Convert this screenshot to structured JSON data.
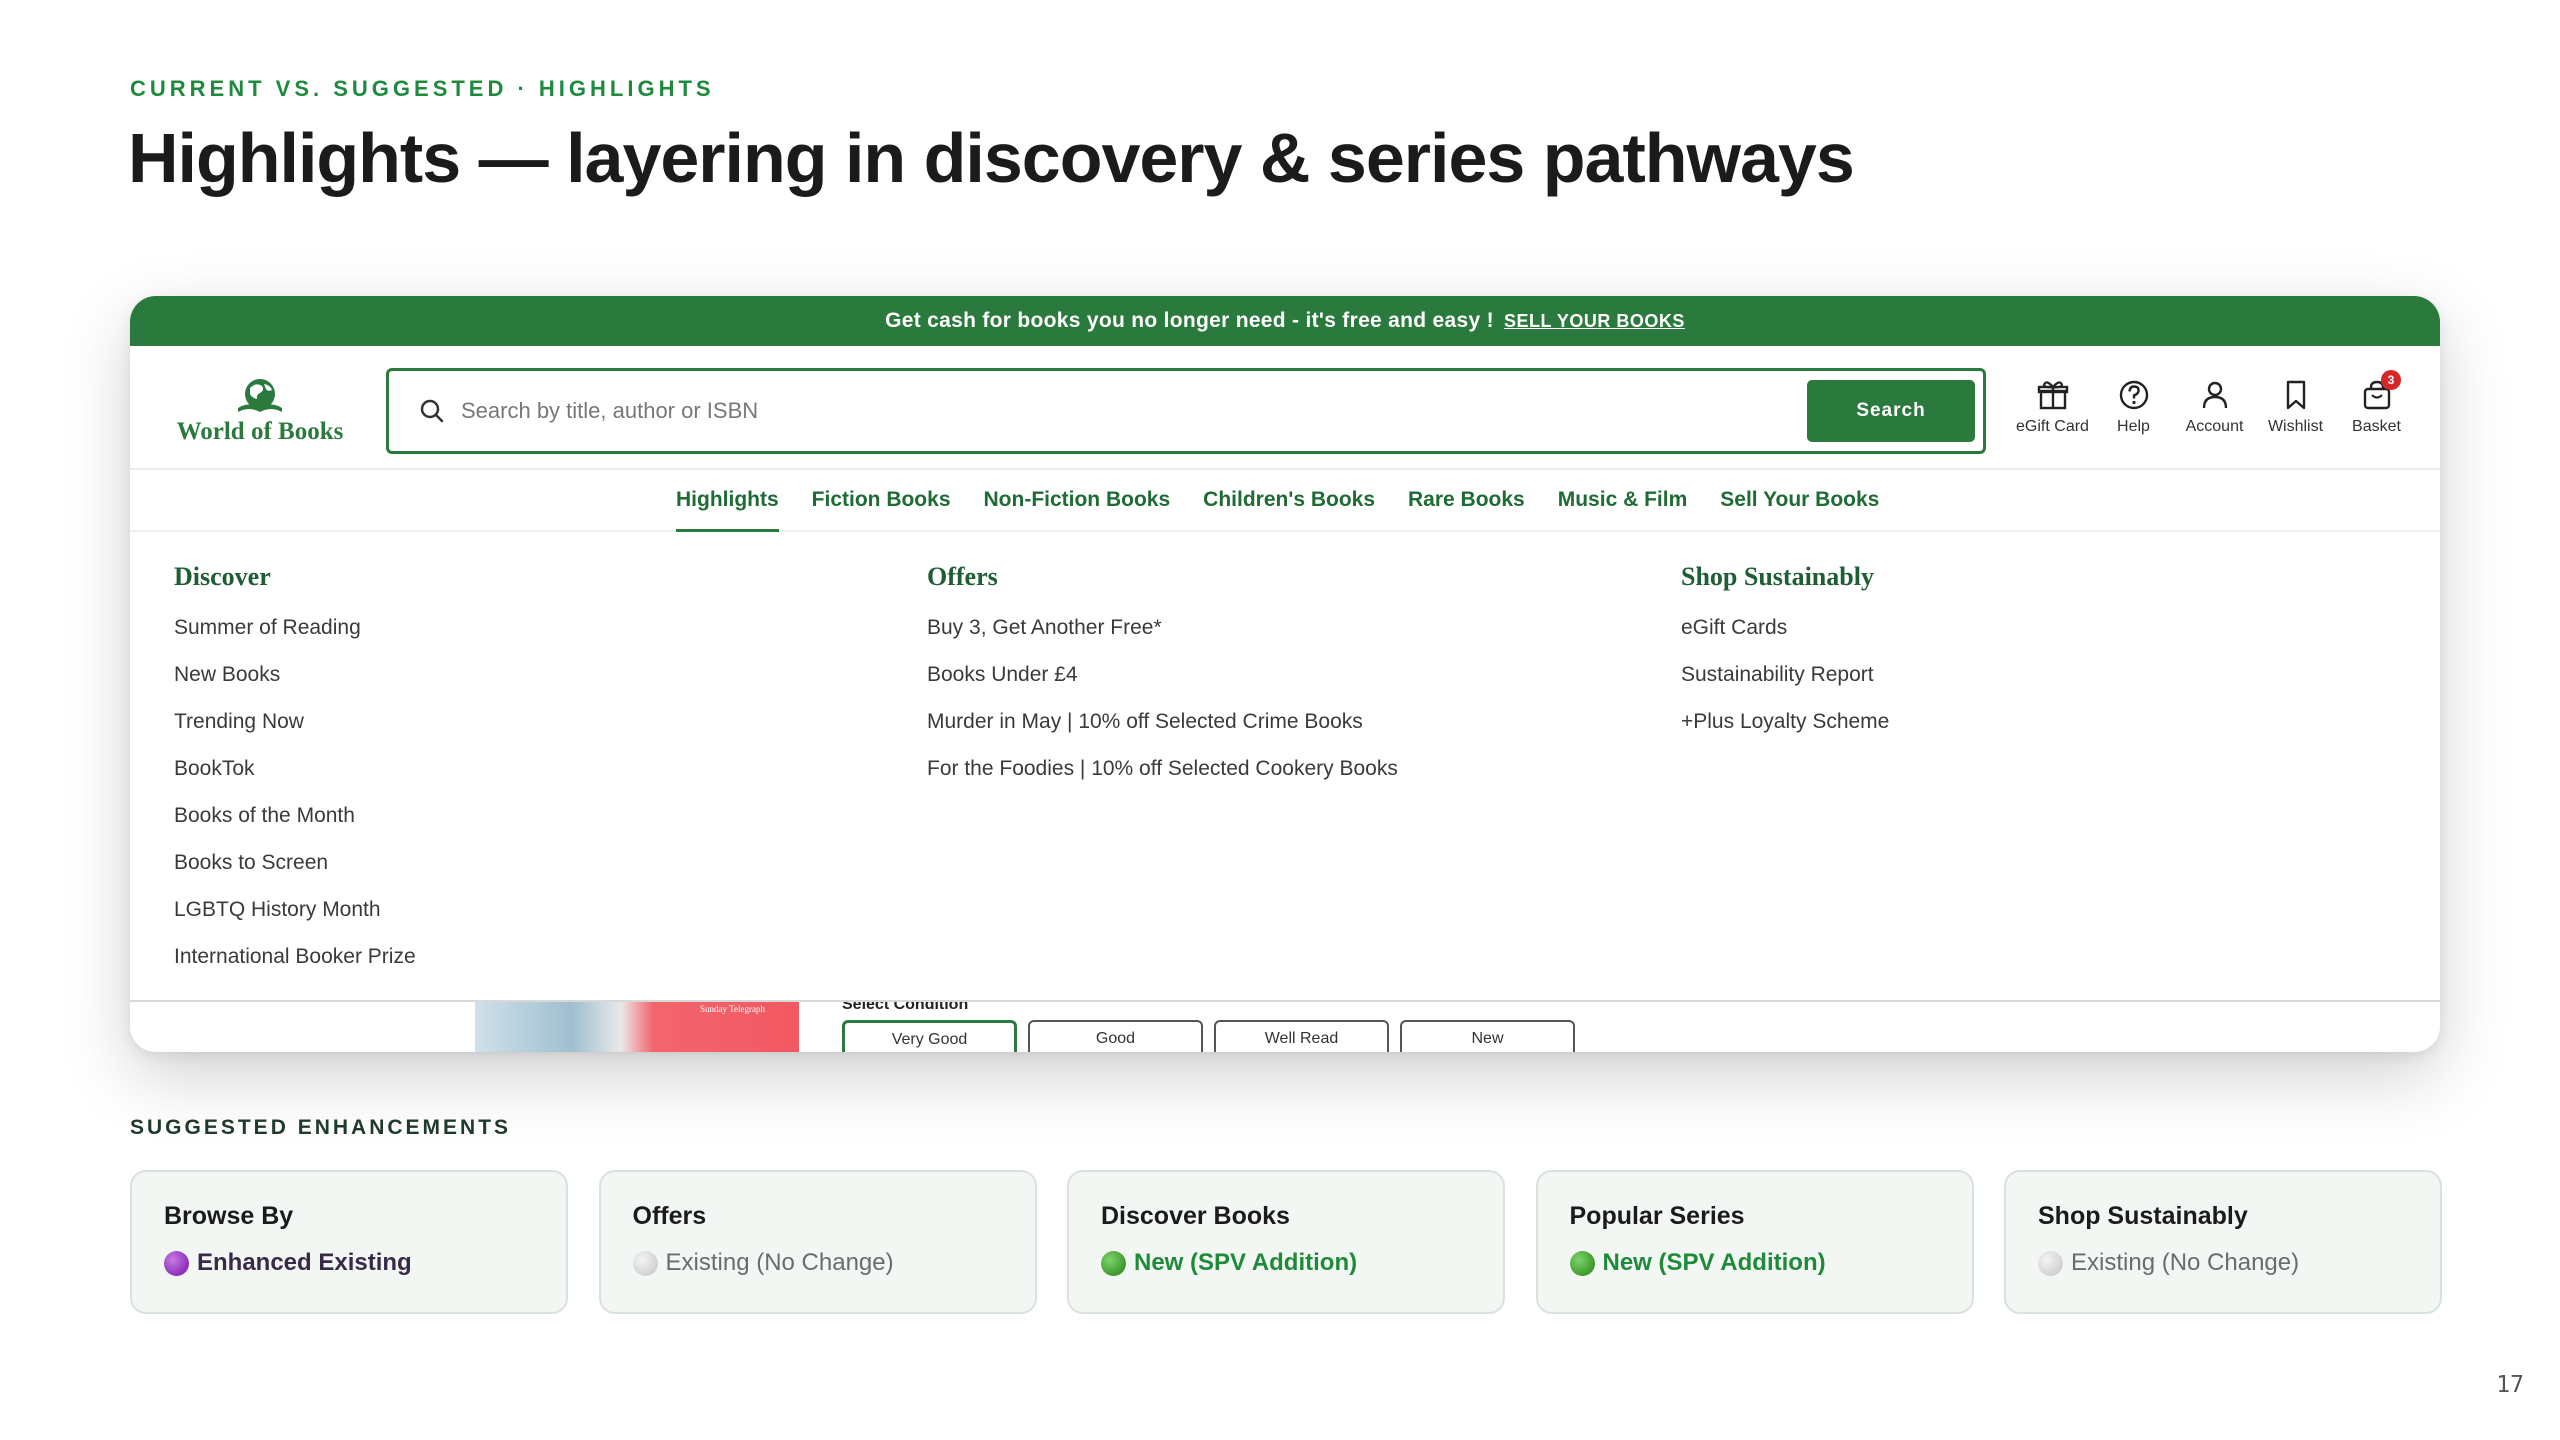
{
  "slide": {
    "eyebrow": "CURRENT VS. SUGGESTED · HIGHLIGHTS",
    "title": "Highlights — layering in discovery & series pathways",
    "page_number": "17"
  },
  "site": {
    "promo": {
      "text": "Get cash for books you no longer need - it's free and easy !",
      "link": "SELL YOUR BOOKS"
    },
    "logo_text": "World of Books",
    "search": {
      "placeholder": "Search by title, author or ISBN",
      "button": "Search"
    },
    "actions": [
      {
        "label": "eGift Card",
        "icon": "gift-icon"
      },
      {
        "label": "Help",
        "icon": "help-icon"
      },
      {
        "label": "Account",
        "icon": "account-icon"
      },
      {
        "label": "Wishlist",
        "icon": "bookmark-icon"
      },
      {
        "label": "Basket",
        "icon": "basket-icon",
        "badge": "3"
      }
    ],
    "nav": [
      {
        "label": "Highlights",
        "active": true
      },
      {
        "label": "Fiction Books"
      },
      {
        "label": "Non-Fiction Books"
      },
      {
        "label": "Children's Books"
      },
      {
        "label": "Rare Books"
      },
      {
        "label": "Music & Film"
      },
      {
        "label": "Sell Your Books"
      }
    ],
    "mega_menu": [
      {
        "heading": "Discover",
        "links": [
          "Summer of Reading",
          "New Books",
          "Trending Now",
          "BookTok",
          "Books of the Month",
          "Books to Screen",
          "LGBTQ History Month",
          "International Booker Prize"
        ]
      },
      {
        "heading": "Offers",
        "links": [
          "Buy 3, Get Another Free*",
          "Books Under £4",
          "Murder in May | 10% off Selected Crime Books",
          "For the Foodies | 10% off Selected Cookery Books"
        ]
      },
      {
        "heading": "Shop Sustainably",
        "links": [
          "eGift Cards",
          "Sustainability Report",
          "+Plus Loyalty Scheme"
        ]
      }
    ],
    "peek": {
      "image_text": "Sunday Telegraph",
      "condition_label": "Select Condition",
      "conditions": [
        "Very Good",
        "Good",
        "Well Read",
        "New"
      ],
      "selected_condition": "Very Good"
    }
  },
  "enhancements": {
    "label": "SUGGESTED ENHANCEMENTS",
    "cards": [
      {
        "title": "Browse By",
        "status": "Enhanced Existing",
        "color": "#8e2fb8"
      },
      {
        "title": "Offers",
        "status": "Existing (No Change)",
        "color": "#cfcfcf"
      },
      {
        "title": "Discover Books",
        "status": "New (SPV Addition)",
        "color": "#3f9a2c"
      },
      {
        "title": "Popular Series",
        "status": "New (SPV Addition)",
        "color": "#3f9a2c"
      },
      {
        "title": "Shop Sustainably",
        "status": "Existing (No Change)",
        "color": "#cfcfcf"
      }
    ]
  },
  "colors": {
    "brand_green": "#2b7a3d",
    "eyebrow_green": "#1e8a3e",
    "badge_red": "#d62828"
  }
}
